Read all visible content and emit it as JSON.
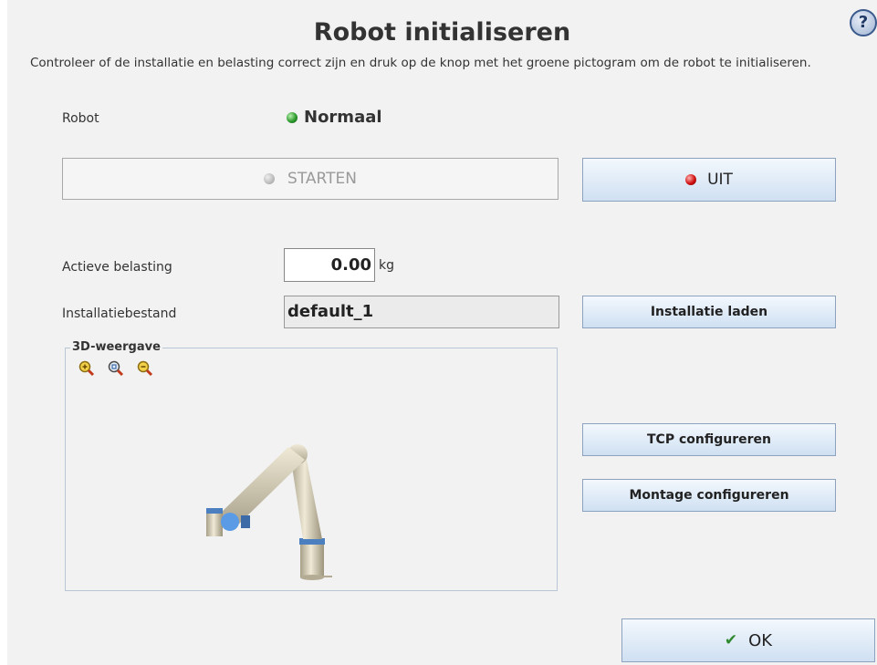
{
  "title": "Robot initialiseren",
  "description": "Controleer of de installatie en belasting correct zijn en druk op de knop met het groene pictogram om de robot te initialiseren.",
  "robot": {
    "label": "Robot",
    "status": "Normaal",
    "status_color": "#2d9a2d"
  },
  "buttons": {
    "start": "STARTEN",
    "off": "UIT",
    "load_installation": "Installatie laden",
    "tcp": "TCP configureren",
    "mount": "Montage configureren",
    "ok": "OK"
  },
  "payload": {
    "label": "Actieve belasting",
    "value": "0.00",
    "unit": "kg"
  },
  "installation": {
    "label": "Installatiebestand",
    "value": "default_1"
  },
  "view3d": {
    "label": "3D-weergave"
  },
  "icons": [
    "help-icon",
    "zoom-in-icon",
    "zoom-reset-icon",
    "zoom-out-icon",
    "green-led-icon",
    "red-led-icon",
    "grey-led-icon",
    "checkmark-icon"
  ],
  "colors": {
    "accent_button": "#cfe0f2",
    "button_border": "#8da2bf",
    "off_led": "#d01010"
  }
}
